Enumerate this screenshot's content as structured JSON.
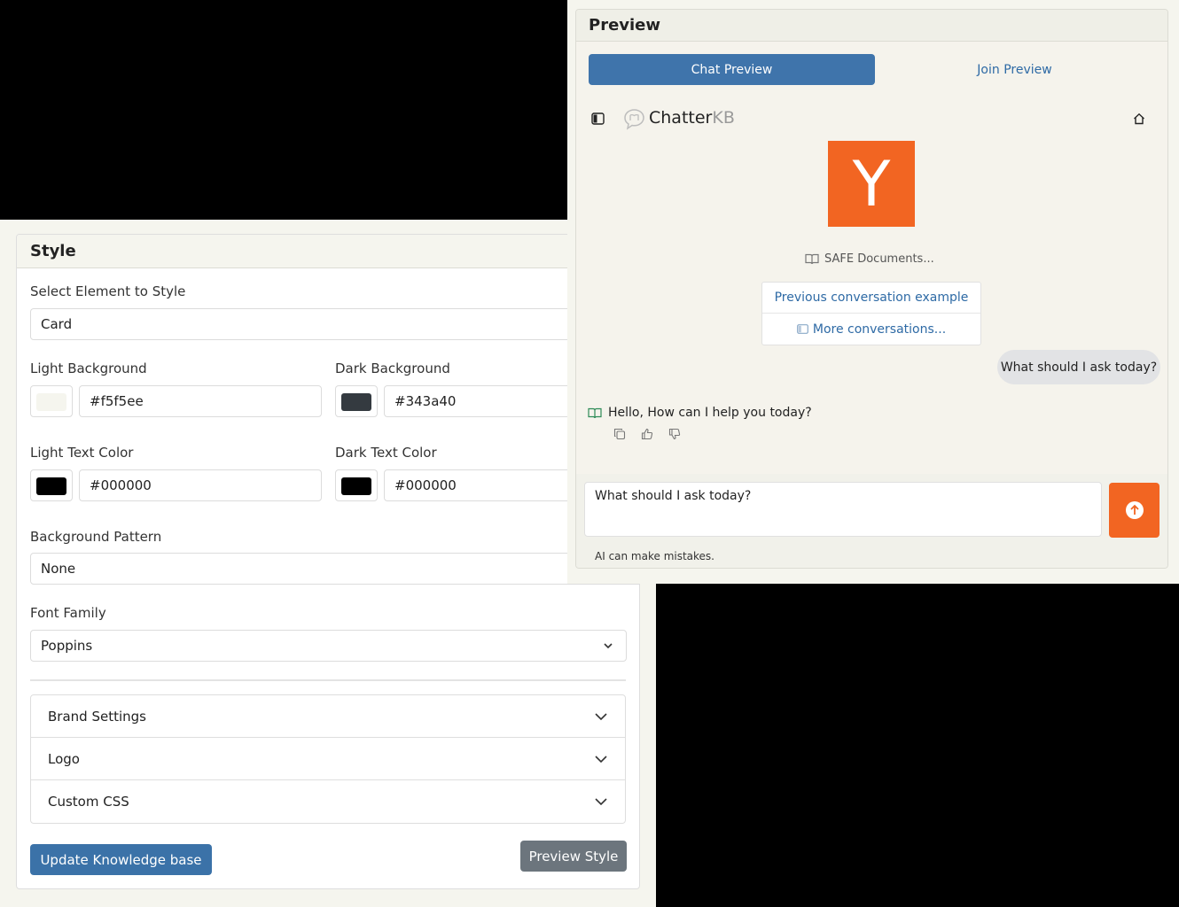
{
  "style_panel": {
    "title": "Style",
    "select_element": {
      "label": "Select Element to Style",
      "value": "Card"
    },
    "light_background": {
      "label": "Light Background",
      "value": "#f5f5ee"
    },
    "dark_background": {
      "label": "Dark Background",
      "value": "#343a40"
    },
    "light_text_color": {
      "label": "Light Text Color",
      "value": "#000000"
    },
    "dark_text_color": {
      "label": "Dark Text Color",
      "value": "#000000"
    },
    "background_pattern": {
      "label": "Background Pattern",
      "value": "None"
    },
    "font_family": {
      "label": "Font Family",
      "value": "Poppins"
    },
    "accordion": [
      {
        "label": "Brand Settings"
      },
      {
        "label": "Logo"
      },
      {
        "label": "Custom CSS"
      }
    ],
    "update_button": "Update Knowledge base",
    "preview_button": "Preview Style"
  },
  "preview_panel": {
    "title": "Preview",
    "tabs": [
      {
        "label": "Chat Preview",
        "active": true
      },
      {
        "label": "Join Preview",
        "active": false
      }
    ],
    "brand": {
      "name_main": "Chatter",
      "name_suffix": "KB"
    },
    "kb_logo_letter": "Y",
    "kb_logo_color": "#f26522",
    "kb_name": "SAFE Documents...",
    "conversation_links": [
      {
        "label": "Previous conversation example"
      },
      {
        "label": "More conversations..."
      }
    ],
    "user_message": "What should I ask today?",
    "bot_message": "Hello, How can I help you today?",
    "composer_value": "What should I ask today?",
    "disclaimer": "AI can make mistakes.",
    "accent_color": "#3f74ab"
  }
}
